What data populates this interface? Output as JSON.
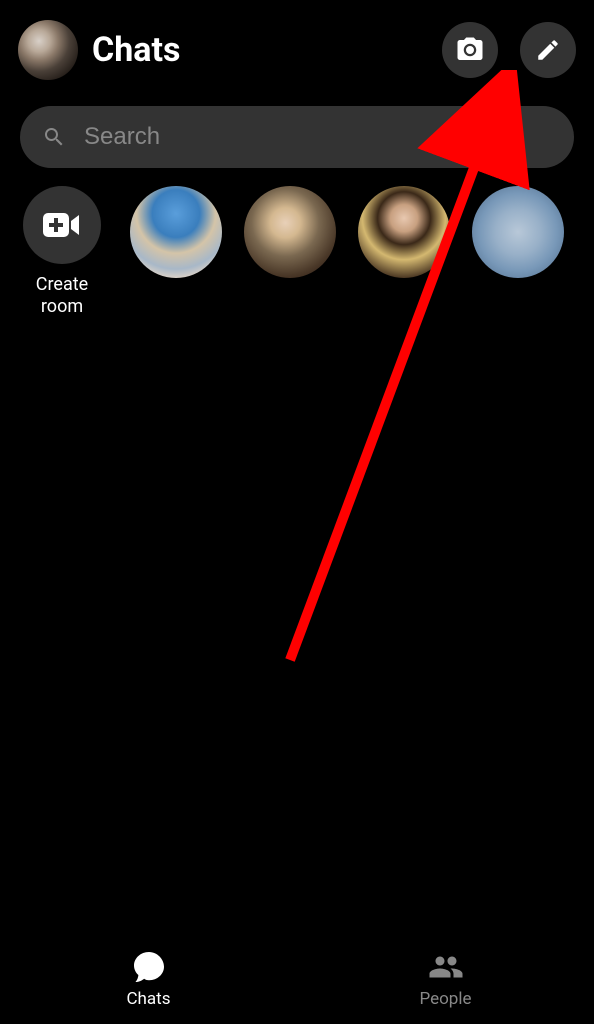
{
  "header": {
    "title": "Chats",
    "camera_icon": "camera-icon",
    "compose_icon": "compose-icon"
  },
  "search": {
    "placeholder": "Search"
  },
  "create_room": {
    "label": "Create room"
  },
  "stories": [
    {
      "name": "story-1"
    },
    {
      "name": "story-2"
    },
    {
      "name": "story-3"
    },
    {
      "name": "story-4"
    }
  ],
  "nav": {
    "chats_label": "Chats",
    "people_label": "People"
  },
  "annotation": {
    "arrow_color": "#ff0000"
  }
}
